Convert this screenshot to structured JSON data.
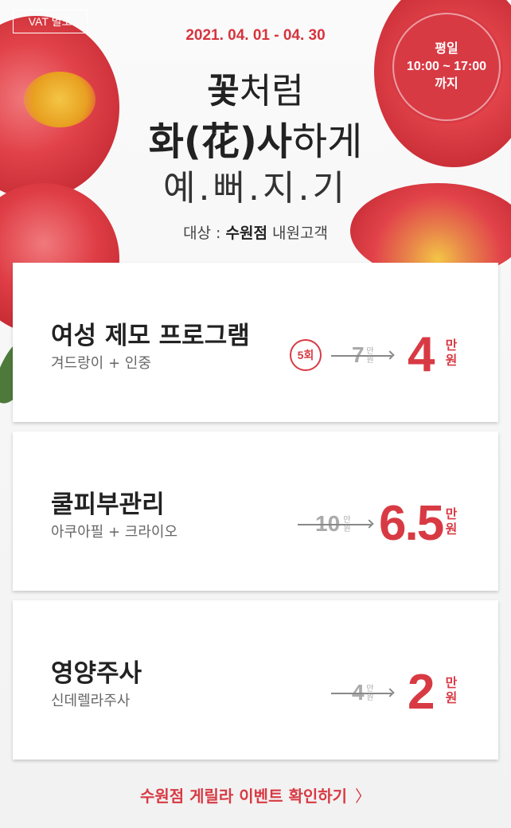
{
  "vat_badge": "VAT 별도",
  "period": "2021. 04. 01 - 04. 30",
  "weekday_badge": {
    "line1": "평일",
    "line2": "10:00 ~ 17:00",
    "line3": "까지"
  },
  "headline": {
    "line1_bold": "꽃",
    "line1_rest": "처럼",
    "line2_bold1": "화(花)사",
    "line2_rest": "하게",
    "line3": "예.뻐.지.기"
  },
  "target": {
    "prefix": "대상 : ",
    "branch": "수원점",
    "suffix": " 내원고객"
  },
  "programs": [
    {
      "title": "여성 제모 프로그램",
      "subtitle": "겨드랑이 + 인중",
      "sessions": "5회",
      "old_price": "7",
      "old_unit": "만원",
      "new_price": "4",
      "new_unit": "만원"
    },
    {
      "title": "쿨피부관리",
      "subtitle": "아쿠아필 + 크라이오",
      "old_price": "10",
      "old_unit": "만원",
      "new_price": "6.5",
      "new_unit": "만원"
    },
    {
      "title": "영양주사",
      "subtitle": "신데렐라주사",
      "old_price": "4",
      "old_unit": "만원",
      "new_price": "2",
      "new_unit": "만원"
    }
  ],
  "cta": {
    "label": "수원점 게릴라 이벤트 확인하기",
    "icon": "chevron-right-icon",
    "chevron": "〉"
  },
  "colors": {
    "accent": "#d83a44",
    "flower": "#e3434a",
    "text": "#222222"
  }
}
